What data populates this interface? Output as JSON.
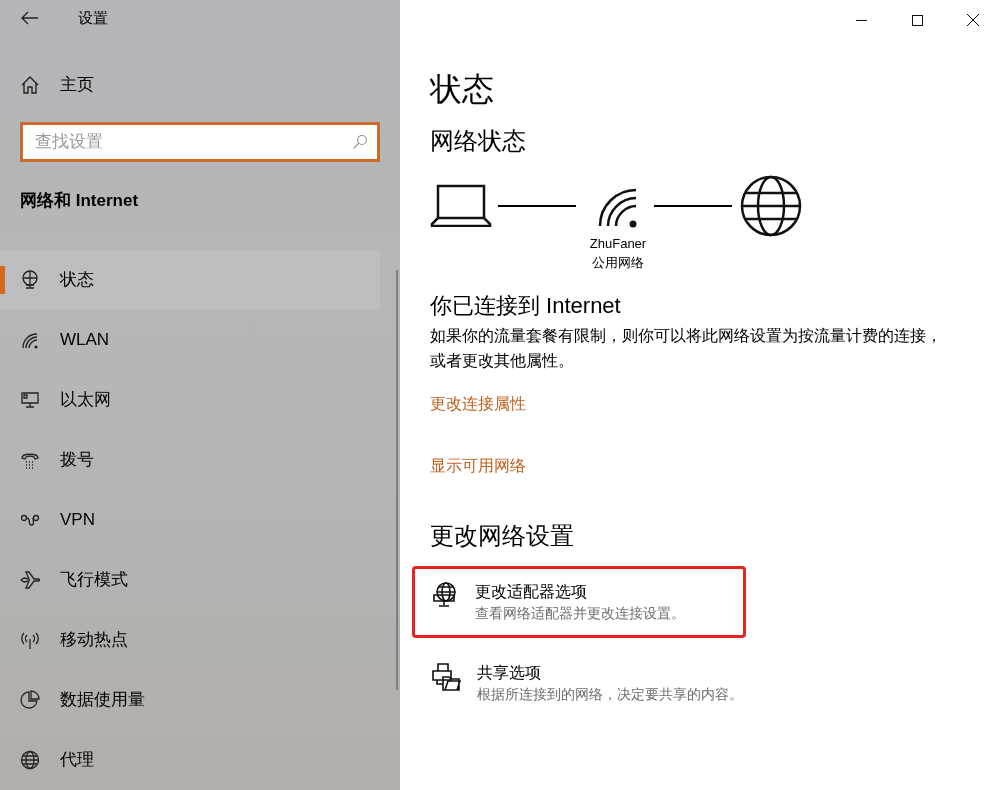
{
  "sidebar": {
    "title": "设置",
    "home": "主页",
    "search": {
      "placeholder": "查找设置"
    },
    "section": "网络和 Internet",
    "items": [
      {
        "kind": "status",
        "label": "状态",
        "selected": true
      },
      {
        "kind": "wlan",
        "label": "WLAN",
        "selected": false
      },
      {
        "kind": "ethernet",
        "label": "以太网",
        "selected": false
      },
      {
        "kind": "dialup",
        "label": "拨号",
        "selected": false
      },
      {
        "kind": "vpn",
        "label": "VPN",
        "selected": false
      },
      {
        "kind": "airplane",
        "label": "飞行模式",
        "selected": false
      },
      {
        "kind": "hotspot",
        "label": "移动热点",
        "selected": false
      },
      {
        "kind": "data",
        "label": "数据使用量",
        "selected": false
      },
      {
        "kind": "proxy",
        "label": "代理",
        "selected": false
      }
    ]
  },
  "main": {
    "title": "状态",
    "network_heading": "网络状态",
    "network_name": "ZhuFaner",
    "network_type": "公用网络",
    "connected_title": "你已连接到 Internet",
    "connected_text": "如果你的流量套餐有限制，则你可以将此网络设置为按流量计费的连接，或者更改其他属性。",
    "links": [
      "更改连接属性",
      "显示可用网络"
    ],
    "change_heading": "更改网络设置",
    "options": [
      {
        "kind": "adapter",
        "title": "更改适配器选项",
        "description": "查看网络适配器并更改连接设置。",
        "highlighted": true
      },
      {
        "kind": "sharing",
        "title": "共享选项",
        "description": "根据所连接到的网络，决定要共享的内容。",
        "highlighted": false
      }
    ]
  }
}
